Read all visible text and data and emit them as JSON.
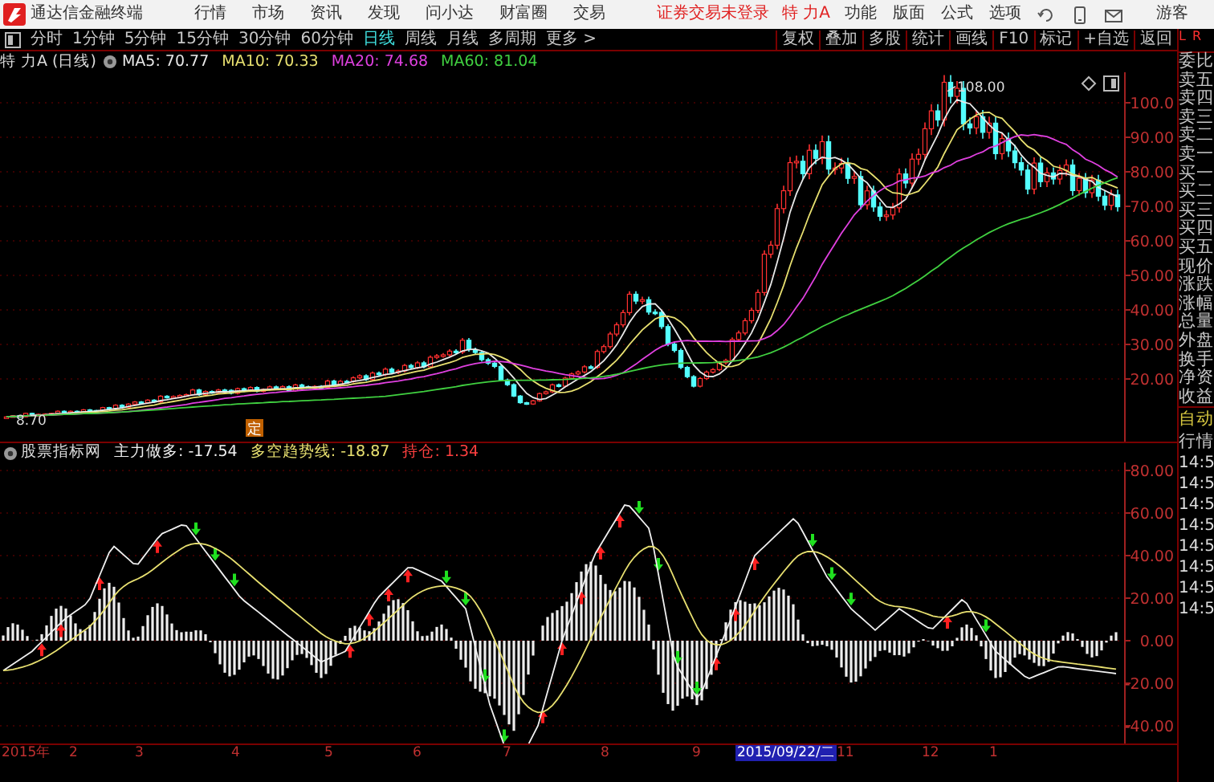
{
  "app": {
    "title": "通达信金融终端",
    "menu": [
      "行情",
      "市场",
      "资讯",
      "发现",
      "问小达",
      "财富圈",
      "交易"
    ],
    "login_status": "证券交易未登录",
    "stock": "特 力A",
    "right_menu": [
      "功能",
      "版面",
      "公式",
      "选项"
    ],
    "user": "游客"
  },
  "toolbar": {
    "periods": [
      {
        "label": "分时",
        "selected": false
      },
      {
        "label": "1分钟",
        "selected": false
      },
      {
        "label": "5分钟",
        "selected": false
      },
      {
        "label": "15分钟",
        "selected": false
      },
      {
        "label": "30分钟",
        "selected": false
      },
      {
        "label": "60分钟",
        "selected": false
      },
      {
        "label": "日线",
        "selected": true
      },
      {
        "label": "周线",
        "selected": false
      },
      {
        "label": "月线",
        "selected": false
      },
      {
        "label": "多周期",
        "selected": false
      },
      {
        "label": "更多 >",
        "selected": false
      }
    ],
    "actions": [
      "复权",
      "叠加",
      "多股",
      "统计",
      "画线",
      "F10",
      "标记",
      "+自选",
      "返回"
    ]
  },
  "price_chart": {
    "title": "特 力A (日线)",
    "ma": [
      {
        "label": "MA5: 70.77",
        "color": "#e8e8e8"
      },
      {
        "label": "MA10: 70.33",
        "color": "#e8e070"
      },
      {
        "label": "MA20: 74.68",
        "color": "#e040e0"
      },
      {
        "label": "MA60: 81.04",
        "color": "#40d040"
      }
    ],
    "high_label": "108.00",
    "low_label": "8.70",
    "flag": "定",
    "axis": [
      "100.0",
      "90.00",
      "80.00",
      "70.00",
      "60.00",
      "50.00",
      "40.00",
      "30.00",
      "20.00"
    ]
  },
  "indicator": {
    "name": "股票指标网",
    "lines": [
      {
        "label": "主力做多: -17.54",
        "color": "#f0f0f0"
      },
      {
        "label": "多空趋势线: -18.87",
        "color": "#e8e070"
      },
      {
        "label": "持仓: 1.34",
        "color": "#ff4040"
      }
    ],
    "axis": [
      "80.00",
      "60.00",
      "40.00",
      "20.00",
      "0.00",
      "-20.00",
      "-40.00"
    ]
  },
  "dates": [
    {
      "label": "2015年",
      "selected": false
    },
    {
      "label": "2",
      "selected": false
    },
    {
      "label": "3",
      "selected": false
    },
    {
      "label": "4",
      "selected": false
    },
    {
      "label": "5",
      "selected": false
    },
    {
      "label": "6",
      "selected": false
    },
    {
      "label": "7",
      "selected": false
    },
    {
      "label": "8",
      "selected": false
    },
    {
      "label": "9",
      "selected": false
    },
    {
      "label": "2015/09/22/二",
      "selected": true
    },
    {
      "label": "11",
      "selected": false
    },
    {
      "label": "12",
      "selected": false
    },
    {
      "label": "1",
      "selected": false
    }
  ],
  "quote_panel": {
    "corner": [
      "L",
      "R"
    ],
    "fields": [
      "委比",
      "卖五",
      "卖四",
      "卖三",
      "卖二",
      "卖一",
      "买一",
      "买二",
      "买三",
      "买四",
      "买五",
      "现价",
      "涨跌",
      "涨幅",
      "总量",
      "外盘",
      "换手",
      "净资",
      "收益"
    ],
    "mode": "自动",
    "ticker_label": "行情",
    "times": [
      "14:5",
      "14:5",
      "14:5",
      "14:5",
      "14:5",
      "14:5",
      "14:5",
      "14:5"
    ]
  }
}
